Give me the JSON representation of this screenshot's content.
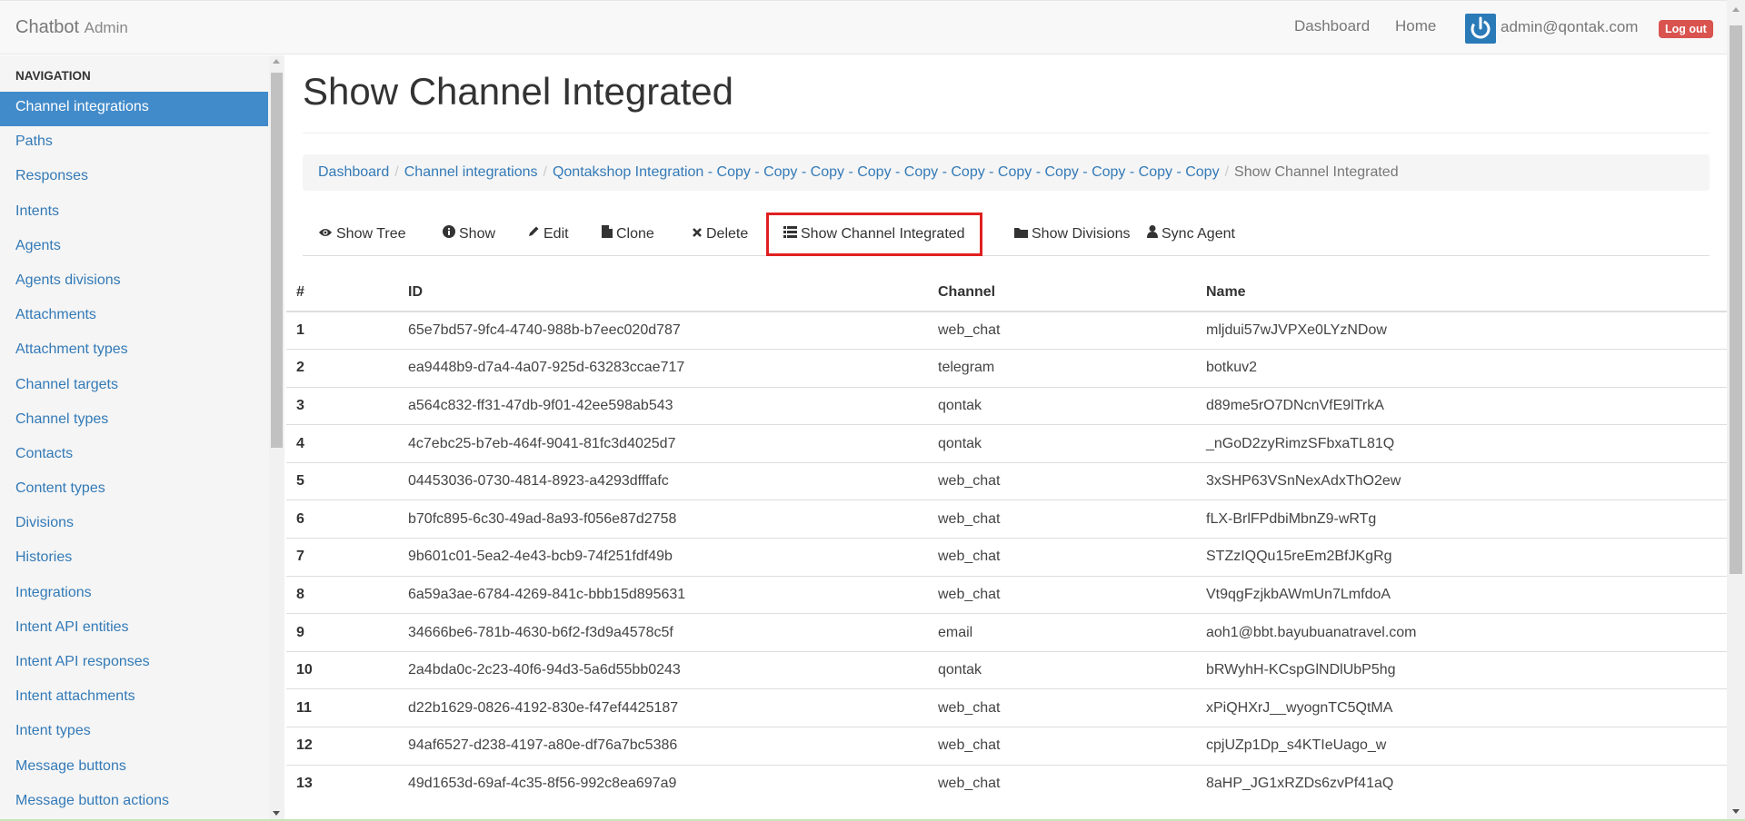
{
  "brand": {
    "name": "Chatbot",
    "sub": "Admin"
  },
  "topnav": {
    "dashboard": "Dashboard",
    "home": "Home",
    "user_email": "admin@qontak.com",
    "logout": "Log out"
  },
  "sidebar": {
    "header": "NAVIGATION",
    "items": [
      {
        "label": "Channel integrations",
        "active": true
      },
      {
        "label": "Paths"
      },
      {
        "label": "Responses"
      },
      {
        "label": "Intents"
      },
      {
        "label": "Agents"
      },
      {
        "label": "Agents divisions"
      },
      {
        "label": "Attachments"
      },
      {
        "label": "Attachment types"
      },
      {
        "label": "Channel targets"
      },
      {
        "label": "Channel types"
      },
      {
        "label": "Contacts"
      },
      {
        "label": "Content types"
      },
      {
        "label": "Divisions"
      },
      {
        "label": "Histories"
      },
      {
        "label": "Integrations"
      },
      {
        "label": "Intent API entities"
      },
      {
        "label": "Intent API responses"
      },
      {
        "label": "Intent attachments"
      },
      {
        "label": "Intent types"
      },
      {
        "label": "Message buttons"
      },
      {
        "label": "Message button actions"
      }
    ]
  },
  "page": {
    "title": "Show Channel Integrated"
  },
  "breadcrumb": {
    "dashboard": "Dashboard",
    "channel_integrations": "Channel integrations",
    "integration": "Qontakshop Integration - Copy - Copy - Copy - Copy - Copy - Copy - Copy - Copy - Copy - Copy - Copy",
    "current": "Show Channel Integrated"
  },
  "tabs": {
    "show_tree": "Show Tree",
    "show": "Show",
    "edit": "Edit",
    "clone": "Clone",
    "delete": "Delete",
    "show_channel_integrated": "Show Channel Integrated",
    "show_divisions": "Show Divisions",
    "sync_agent": "Sync Agent"
  },
  "table": {
    "headers": {
      "num": "#",
      "id": "ID",
      "channel": "Channel",
      "name": "Name"
    },
    "rows": [
      {
        "num": "1",
        "id": "65e7bd57-9fc4-4740-988b-b7eec020d787",
        "channel": "web_chat",
        "name": "mljdui57wJVPXe0LYzNDow"
      },
      {
        "num": "2",
        "id": "ea9448b9-d7a4-4a07-925d-63283ccae717",
        "channel": "telegram",
        "name": "botkuv2"
      },
      {
        "num": "3",
        "id": "a564c832-ff31-47db-9f01-42ee598ab543",
        "channel": "qontak",
        "name": "d89me5rO7DNcnVfE9lTrkA"
      },
      {
        "num": "4",
        "id": "4c7ebc25-b7eb-464f-9041-81fc3d4025d7",
        "channel": "qontak",
        "name": "_nGoD2zyRimzSFbxaTL81Q"
      },
      {
        "num": "5",
        "id": "04453036-0730-4814-8923-a4293dfffafc",
        "channel": "web_chat",
        "name": "3xSHP63VSnNexAdxThO2ew"
      },
      {
        "num": "6",
        "id": "b70fc895-6c30-49ad-8a93-f056e87d2758",
        "channel": "web_chat",
        "name": "fLX-BrlFPdbiMbnZ9-wRTg"
      },
      {
        "num": "7",
        "id": "9b601c01-5ea2-4e43-bcb9-74f251fdf49b",
        "channel": "web_chat",
        "name": "STZzIQQu15reEm2BfJKgRg"
      },
      {
        "num": "8",
        "id": "6a59a3ae-6784-4269-841c-bbb15d895631",
        "channel": "web_chat",
        "name": "Vt9qgFzjkbAWmUn7LmfdoA"
      },
      {
        "num": "9",
        "id": "34666be6-781b-4630-b6f2-f3d9a4578c5f",
        "channel": "email",
        "name": "aoh1@bbt.bayubuanatravel.com"
      },
      {
        "num": "10",
        "id": "2a4bda0c-2c23-40f6-94d3-5a6d55bb0243",
        "channel": "qontak",
        "name": "bRWyhH-KCspGlNDlUbP5hg"
      },
      {
        "num": "11",
        "id": "d22b1629-0826-4192-830e-f47ef4425187",
        "channel": "web_chat",
        "name": "xPiQHXrJ__wyognTC5QtMA"
      },
      {
        "num": "12",
        "id": "94af6527-d238-4197-a80e-df76a7bc5386",
        "channel": "web_chat",
        "name": "cpjUZp1Dp_s4KTIeUago_w"
      },
      {
        "num": "13",
        "id": "49d1653d-69af-4c35-8f56-992c8ea697a9",
        "channel": "web_chat",
        "name": "8aHP_JG1xRZDs6zvPf41aQ"
      }
    ]
  },
  "colors": {
    "link": "#337ab7",
    "active_bg": "#428bca",
    "highlight_border": "#e02020",
    "logout": "#d9534f"
  },
  "icons": {
    "show_tree": "eye-icon",
    "show": "info-circle-icon",
    "edit": "pencil-icon",
    "clone": "file-icon",
    "delete": "times-icon",
    "show_channel_integrated": "list-icon",
    "show_divisions": "folder-icon",
    "sync_agent": "user-icon",
    "user": "power-icon"
  }
}
